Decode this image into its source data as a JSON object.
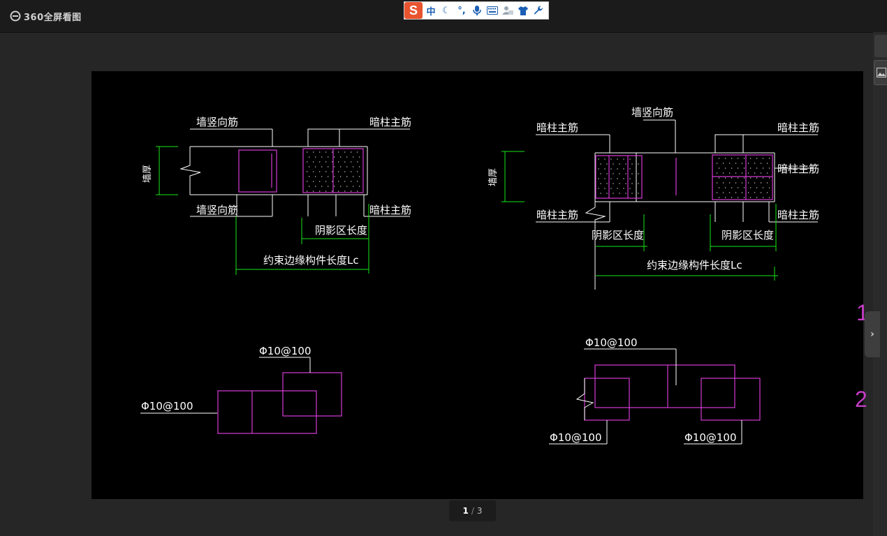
{
  "app": {
    "title": "360全屏看图"
  },
  "ime": {
    "logo": "S",
    "mode": "中"
  },
  "drawing": {
    "left": {
      "wall_thickness": "墙厚",
      "wall_vertical_top": "墙竖向筋",
      "wall_vertical_bottom": "墙竖向筋",
      "hidden_col_top": "暗柱主筋",
      "hidden_col_bottom": "暗柱主筋",
      "shadow_length": "阴影区长度",
      "edge_length": "约束边缘构件长度Lc",
      "stirrup_top": "Φ10@100",
      "stirrup_left": "Φ10@100"
    },
    "right": {
      "wall_thickness": "墙厚",
      "wall_vertical": "墙竖向筋",
      "hidden_col_tl": "暗柱主筋",
      "hidden_col_bl": "暗柱主筋",
      "hidden_col_tr": "暗柱主筋",
      "hidden_col_mr": "暗柱主筋",
      "hidden_col_br": "暗柱主筋",
      "shadow_length_left": "阴影区长度",
      "shadow_length_right": "阴影区长度",
      "edge_length": "约束边缘构件长度Lc",
      "stirrup_top": "Φ10@100",
      "stirrup_bl": "Φ10@100",
      "stirrup_br": "Φ10@100"
    },
    "edge_labels": [
      "1",
      "2"
    ]
  },
  "pager": {
    "current": "1",
    "separator": "/",
    "total": "3"
  },
  "colors": {
    "line": "#ffffff",
    "dim": "#19e619",
    "rebar": "#d63bd6",
    "background": "#000000"
  }
}
